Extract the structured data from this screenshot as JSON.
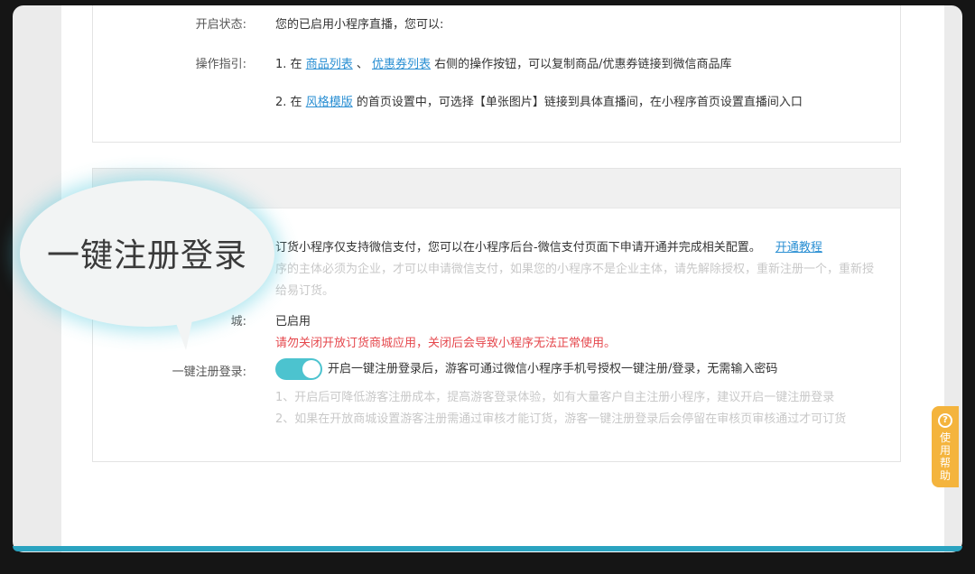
{
  "top_panel": {
    "status_label": "开启状态:",
    "status_value": "您的已启用小程序直播，您可以:",
    "guide_label": "操作指引:",
    "guide_1_prefix": "1. 在",
    "guide_1_link_a": "商品列表",
    "guide_1_sep": "、",
    "guide_1_link_b": "优惠券列表",
    "guide_1_suffix": "右侧的操作按钮，可以复制商品/优惠券链接到微信商品库",
    "guide_2_prefix": "2. 在",
    "guide_2_link": "风格模版",
    "guide_2_suffix": "的首页设置中，可选择【单张图片】链接到具体直播间，在小程序首页设置直播间入口"
  },
  "bottom_panel": {
    "pay_note_visible": "订货小程序仅支持微信支付，您可以在小程序后台-微信支付页面下申请开通并完成相关配置。",
    "pay_tutorial_link": "开通教程",
    "pay_note_gray_1": "序的主体必须为企业，才可以申请微信支付，如果您的小程序不是企业主体，请先解除授权，重新注册一个，重新授",
    "pay_note_gray_2": "给易订货。",
    "mall_label_partial": "城:",
    "mall_value": "已启用",
    "mall_warning": "请勿关闭开放订货商城应用，关闭后会导致小程序无法正常使用。",
    "register_label": "一键注册登录:",
    "register_toggle_on": true,
    "register_desc": "开启一键注册登录后，游客可通过微信小程序手机号授权一键注册/登录，无需输入密码",
    "register_tip_1": "1、开启后可降低游客注册成本，提高游客登录体验，如有大量客户自主注册小程序，建议开启一键注册登录",
    "register_tip_2": "2、如果在开放商城设置游客注册需通过审核才能订货，游客一键注册登录后会停留在审核页审核通过才可订货"
  },
  "help_tab": {
    "icon": "question-circle-icon",
    "icon_glyph": "?",
    "label": "使用帮助"
  },
  "callout": {
    "text": "一键注册登录"
  },
  "colors": {
    "accent": "#2aa3c0",
    "toggle": "#4cc3cf",
    "link": "#2a8fd3",
    "warning": "#e5484d",
    "help_tab": "#f4b43d"
  }
}
